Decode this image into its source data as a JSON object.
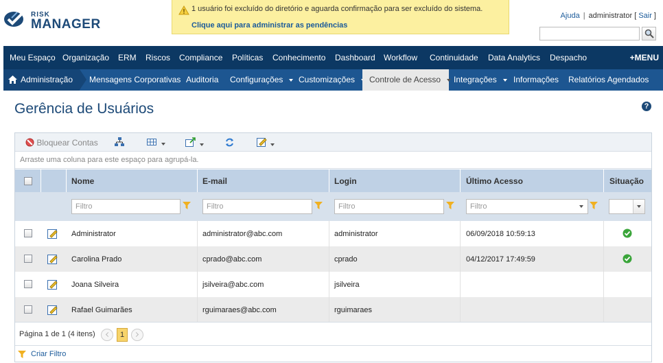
{
  "header": {
    "logo_small": "RISK",
    "logo_large": "MANAGER",
    "notice_text": "1 usuário foi excluído do diretório e aguarda confirmação para ser excluído do sistema.",
    "notice_link": "Clique aqui para administrar as pendências",
    "help_link": "Ajuda",
    "username": "administrator",
    "logout_link": "Sair"
  },
  "main_nav": {
    "items": [
      "Meu Espaço",
      "Organização",
      "ERM",
      "Riscos",
      "Compliance",
      "Políticas",
      "Conhecimento",
      "Dashboard",
      "Workflow",
      "Continuidade",
      "Data Analytics",
      "Despacho"
    ],
    "menu_label": "MENU"
  },
  "sub_nav": {
    "home": "Administração",
    "items": [
      "Mensagens Corporativas",
      "Auditoria",
      "Configurações",
      "Customizações",
      "Controle de Acesso",
      "Integrações",
      "Informações",
      "Relatórios Agendados"
    ],
    "active": "Controle de Acesso"
  },
  "page": {
    "title": "Gerência de Usuários",
    "help": "?"
  },
  "toolbar": {
    "block_accounts": "Bloquear Contas"
  },
  "grid": {
    "group_hint": "Arraste uma coluna para este espaço para agrupá-la.",
    "columns": [
      "Nome",
      "E-mail",
      "Login",
      "Último Acesso",
      "Situação"
    ],
    "filter_placeholder": "Filtro",
    "rows": [
      {
        "name": "Administrator",
        "email": "administrator@abc.com",
        "login": "administrator",
        "last_access": "06/09/2018 10:59:13",
        "status": "active"
      },
      {
        "name": "Carolina Prado",
        "email": "cprado@abc.com",
        "login": "cprado",
        "last_access": "04/12/2017 17:49:59",
        "status": "active"
      },
      {
        "name": "Joana Silveira",
        "email": "jsilveira@abc.com",
        "login": "jsilveira",
        "last_access": "",
        "status": ""
      },
      {
        "name": "Rafael Guimarães",
        "email": "rguimaraes@abc.com",
        "login": "rguimaraes",
        "last_access": "",
        "status": ""
      }
    ],
    "pager_text": "Página 1 de 1 (4 itens)",
    "current_page": "1",
    "create_filter": "Criar Filtro"
  },
  "colors": {
    "nav_dark": "#0c3863",
    "nav_sub": "#1d5691",
    "header_row": "#bfd1e5",
    "notice_bg": "#fcf0a0",
    "status_ok": "#3aa53a"
  }
}
